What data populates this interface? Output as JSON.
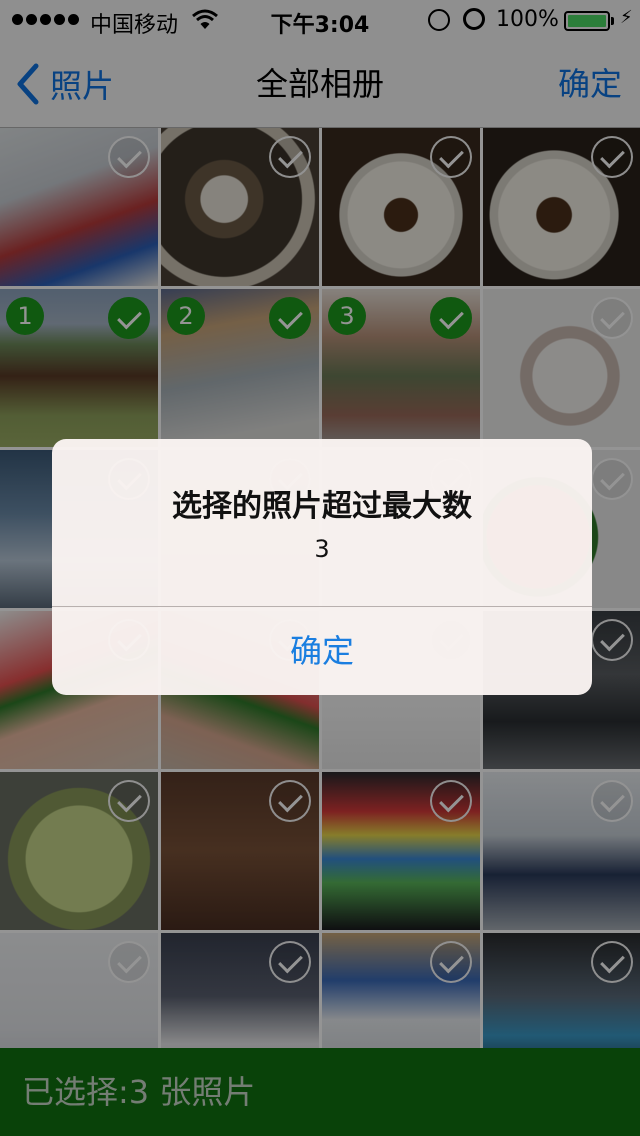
{
  "status_bar": {
    "carrier": "中国移动",
    "time": "下午3:04",
    "battery": "100%"
  },
  "nav": {
    "back_label": "照片",
    "title": "全部相册",
    "confirm_label": "确定"
  },
  "grid": {
    "photos": [
      {
        "id": 1,
        "selected": false,
        "bg": "linear-gradient(160deg,#dfe4e6 0%,#c9ced4 35%,#b83a3a 60%,#2b5fb8 80%,#e8e6e2 100%)"
      },
      {
        "id": 2,
        "selected": false,
        "bg": "radial-gradient(circle at 40% 45%,#e7e2d8 0 18%,#6b5a46 19% 30%,#3e362c 31% 60%,#cbc3b4 61% 70%,#4a4036 71%)"
      },
      {
        "id": 3,
        "selected": false,
        "bg": "radial-gradient(circle at 50% 55%,#4a2f1a 0 14%,#f2eee4 15% 45%,#d6d2c8 46% 52%,#3a2a1e 53%)"
      },
      {
        "id": 4,
        "selected": false,
        "bg": "radial-gradient(circle at 45% 55%,#4a2f1a 0 14%,#f2eee4 15% 45%,#d6d2c8 46% 52%,#2a221a 53%)"
      },
      {
        "id": 5,
        "selected": true,
        "order": "1",
        "bg": "linear-gradient(180deg,#8ea4bf 0%,#a6b5c6 22%,#6d8a5a 35%,#5a3a26 55%,#8fa15c 80%,#9bae64 100%)"
      },
      {
        "id": 6,
        "selected": true,
        "order": "2",
        "bg": "linear-gradient(170deg,#5d6b8f 0%,#c9a57a 25%,#a8b2b8 55%,#dcdcda 85%)"
      },
      {
        "id": 7,
        "selected": true,
        "order": "3",
        "bg": "linear-gradient(180deg,#e8e0d8 0%,#b8927a 30%,#6b7a56 55%,#9a6a5a 80%,#a8a6a2 100%)"
      },
      {
        "id": 8,
        "selected": false,
        "bg": "radial-gradient(ellipse at 55% 55%,#f2f0ec 0 30%,#c9b8b0 31% 40%,#ececea 41%)"
      },
      {
        "id": 9,
        "selected": false,
        "bg": "linear-gradient(180deg,#3c5a78 0%,#6a8aa8 40%,#b8c8d8 70%,#5a6a7a 100%)"
      },
      {
        "id": 10,
        "selected": false,
        "bg": "linear-gradient(180deg,#d8d0c8 0%,#c8bdb0 100%)"
      },
      {
        "id": 11,
        "selected": false,
        "bg": "linear-gradient(180deg,#e8e8e8 0%,#d8d8d8 100%)"
      },
      {
        "id": 12,
        "selected": false,
        "bg": "radial-gradient(circle at 35% 55%,#d42a2a 0 38%,#2f7a2a 39% 44%,#eaeaea 45%)"
      },
      {
        "id": 13,
        "selected": false,
        "bg": "linear-gradient(160deg,#f4f2f0 0%,#e85050 35%,#2f7a2a 45%,#e8b8a0 60%,#d8c8b8 100%)"
      },
      {
        "id": 14,
        "selected": false,
        "bg": "linear-gradient(200deg,#f0ece8 0%,#e05050 45%,#2f7a2a 55%,#d8a890 75%,#c8b8a8 100%)"
      },
      {
        "id": 15,
        "selected": false,
        "bg": "linear-gradient(180deg,#ffffff 0%,#f6f6f6 60%,#e8e8e8 100%)"
      },
      {
        "id": 16,
        "selected": false,
        "bg": "linear-gradient(180deg,#3a3f44 0%,#5a5e62 40%,#2a2e32 70%,#6a6e72 100%)"
      },
      {
        "id": 17,
        "selected": false,
        "bg": "radial-gradient(circle at 50% 55%,#c6d68a 0 45%,#8a9a5a 46% 60%,#6a6e62 61%)"
      },
      {
        "id": 18,
        "selected": false,
        "bg": "linear-gradient(180deg,#5a3a2a 0%,#7a5238 50%,#4a2e22 100%)"
      },
      {
        "id": 19,
        "selected": false,
        "bg": "linear-gradient(180deg,#2a2a2e 0%,#d83a3a 25%,#e8d84a 40%,#3a8ad8 55%,#5ab85a 70%,#1a1a1e 100%)"
      },
      {
        "id": 20,
        "selected": false,
        "bg": "linear-gradient(180deg,#e8ecf0 0%,#c8d0d8 40%,#2a3a5a 65%,#a8b0b8 100%)"
      },
      {
        "id": 21,
        "selected": false,
        "bg": "linear-gradient(180deg,#f0f2f4 0%,#e4e6ea 60%,#c8ccd2 100%)"
      },
      {
        "id": 22,
        "selected": false,
        "bg": "linear-gradient(180deg,#3a4050 0%,#5a6070 40%,#e8e8ea 70%,#d8d8da 100%)"
      },
      {
        "id": 23,
        "selected": false,
        "bg": "linear-gradient(180deg,#c8a878 0%,#3a6ab8 30%,#e8ecf0 55%,#c8ccd0 100%)"
      },
      {
        "id": 24,
        "selected": false,
        "bg": "linear-gradient(180deg,#2a2c2e 0%,#5a6a7a 40%,#3a9ac8 65%,#1a1c1e 100%)"
      }
    ]
  },
  "alert": {
    "title": "选择的照片超过最大数",
    "message": "3",
    "button_label": "确定"
  },
  "bottom_bar": {
    "selection_text": "已选择:3 张照片"
  }
}
